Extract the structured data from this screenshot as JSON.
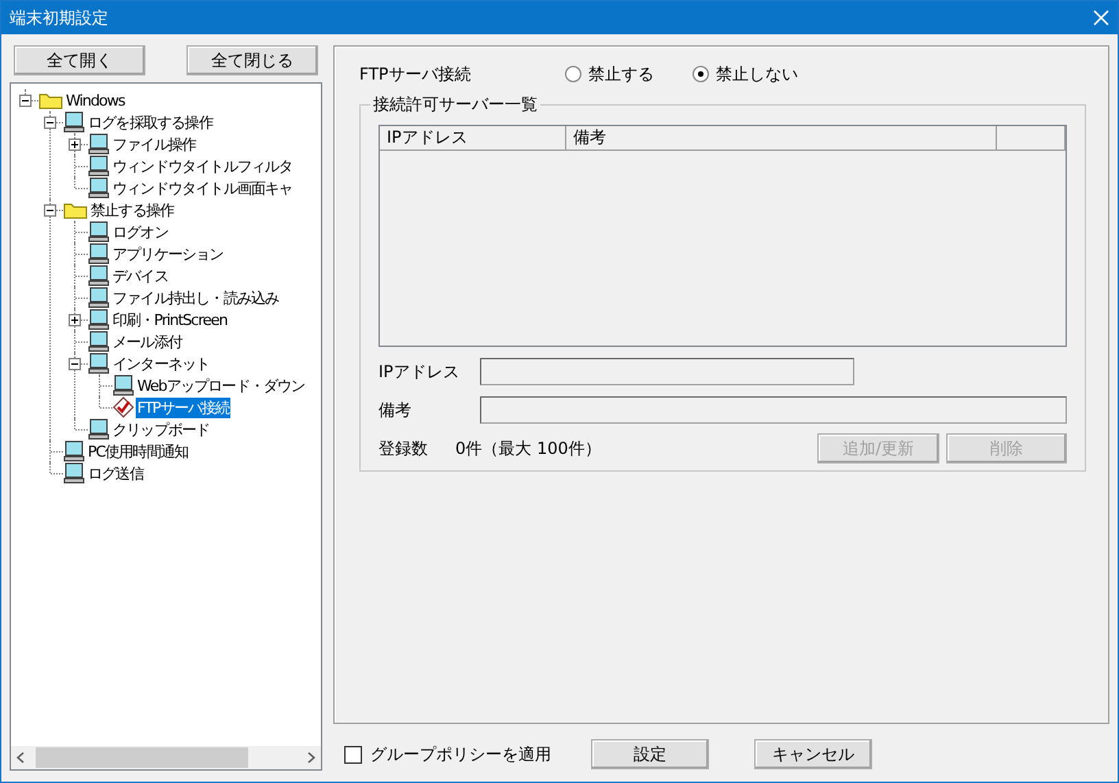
{
  "window": {
    "title": "端末初期設定"
  },
  "tree_buttons": [
    "全て開く",
    "全て閉じる"
  ],
  "tree": [
    {
      "label": "Windows",
      "kind": "folder",
      "expanded": true,
      "selected": false,
      "children": [
        {
          "label": "ログを採取する操作",
          "kind": "computer",
          "expanded": true,
          "selected": false,
          "children": [
            {
              "label": "ファイル操作",
              "kind": "computer",
              "expanded": false,
              "selected": false
            },
            {
              "label": "ウィンドウタイトルフィルタ",
              "kind": "computer",
              "selected": false
            },
            {
              "label": "ウィンドウタイトル画面キャ",
              "kind": "computer",
              "selected": false
            }
          ]
        },
        {
          "label": "禁止する操作",
          "kind": "folder",
          "expanded": true,
          "selected": false,
          "children": [
            {
              "label": "ログオン",
              "kind": "computer",
              "selected": false
            },
            {
              "label": "アプリケーション",
              "kind": "computer",
              "selected": false
            },
            {
              "label": "デバイス",
              "kind": "computer",
              "selected": false
            },
            {
              "label": "ファイル持出し・読み込み",
              "kind": "computer",
              "selected": false
            },
            {
              "label": "印刷・PrintScreen",
              "kind": "computer",
              "expanded": false,
              "selected": false
            },
            {
              "label": "メール添付",
              "kind": "computer",
              "selected": false
            },
            {
              "label": "インターネット",
              "kind": "computer",
              "expanded": true,
              "selected": false,
              "children": [
                {
                  "label": "Webアップロード・ダウン",
                  "kind": "computer",
                  "selected": false
                },
                {
                  "label": "FTPサーバ接続",
                  "kind": "check",
                  "selected": true
                }
              ]
            },
            {
              "label": "クリップボード",
              "kind": "computer",
              "selected": false
            }
          ]
        },
        {
          "label": "PC使用時間通知",
          "kind": "computer",
          "selected": false
        },
        {
          "label": "ログ送信",
          "kind": "computer",
          "selected": false
        }
      ]
    }
  ],
  "ftp": {
    "label": "FTPサーバ接続",
    "options": [
      {
        "label": "禁止する",
        "selected": false
      },
      {
        "label": "禁止しない",
        "selected": true
      }
    ]
  },
  "server_list": {
    "title": "接続許可サーバー一覧",
    "columns": [
      "IPアドレス",
      "備考"
    ]
  },
  "fields": [
    {
      "label": "IPアドレス"
    },
    {
      "label": "備考"
    }
  ],
  "count": {
    "label": "登録数",
    "value": "0件（最大 100件）"
  },
  "actions": [
    {
      "label": "追加/更新",
      "disabled": true
    },
    {
      "label": "削除",
      "disabled": true
    }
  ],
  "group_policy": {
    "label": "グループポリシーを適用",
    "checked": false
  },
  "buttons": [
    "設定",
    "キャンセル"
  ]
}
